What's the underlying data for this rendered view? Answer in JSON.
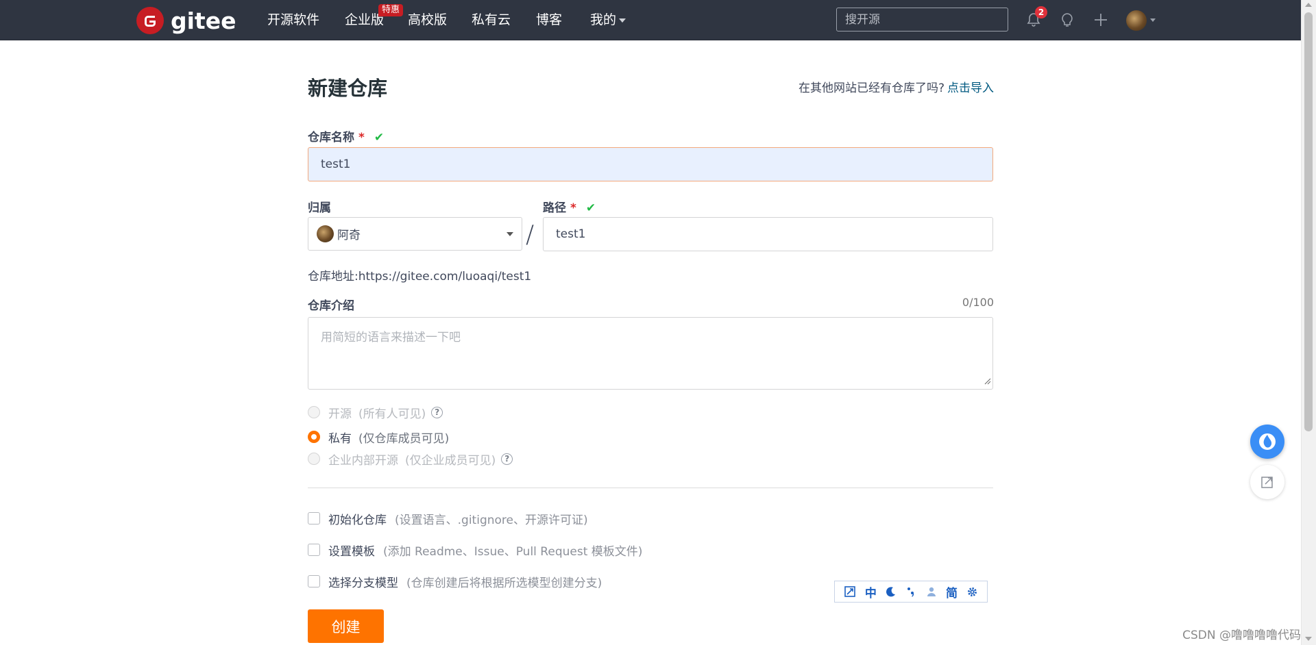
{
  "nav": {
    "logo_text": "gitee",
    "items": [
      "开源软件",
      "企业版",
      "高校版",
      "私有云",
      "博客",
      "我的"
    ],
    "badge": "特惠",
    "search_placeholder": "搜开源",
    "notification_count": "2"
  },
  "form": {
    "title": "新建仓库",
    "import_hint": "在其他网站已经有仓库了吗?",
    "import_link": "点击导入",
    "name_label": "仓库名称",
    "name_value": "test1",
    "owner_label": "归属",
    "owner_value": "阿奇",
    "path_label": "路径",
    "path_value": "test1",
    "required_mark": "*",
    "check_mark": "✔",
    "slash": "/",
    "repo_url_label": "仓库地址:",
    "repo_url": "https://gitee.com/luoaqi/test1",
    "intro_label": "仓库介绍",
    "intro_counter": "0/100",
    "intro_placeholder": "用简短的语言来描述一下吧",
    "visibility": [
      {
        "label": "开源",
        "desc": "(所有人可见)",
        "selected": false,
        "disabled": true
      },
      {
        "label": "私有",
        "desc": "(仅仓库成员可见)",
        "selected": true,
        "disabled": false
      },
      {
        "label": "企业内部开源",
        "desc": "(仅企业成员可见)",
        "selected": false,
        "disabled": true
      }
    ],
    "options": [
      {
        "label": "初始化仓库",
        "desc": "(设置语言、.gitignore、开源许可证)"
      },
      {
        "label": "设置模板",
        "desc": "(添加 Readme、Issue、Pull Request 模板文件)"
      },
      {
        "label": "选择分支模型",
        "desc": "(仓库创建后将根据所选模型创建分支)"
      }
    ],
    "create_button": "创建"
  },
  "ime": {
    "items": [
      "中",
      "简"
    ]
  },
  "watermark": "CSDN @噜噜噜噜代码",
  "colors": {
    "nav_bg": "#2f3541",
    "brand": "#c71d23",
    "accent": "#fe7300",
    "link": "#005980",
    "success": "#21ba45"
  },
  "icons": [
    "bell-icon",
    "lightbulb-icon",
    "plus-icon",
    "question-icon",
    "checkmark-icon",
    "edit-icon"
  ]
}
